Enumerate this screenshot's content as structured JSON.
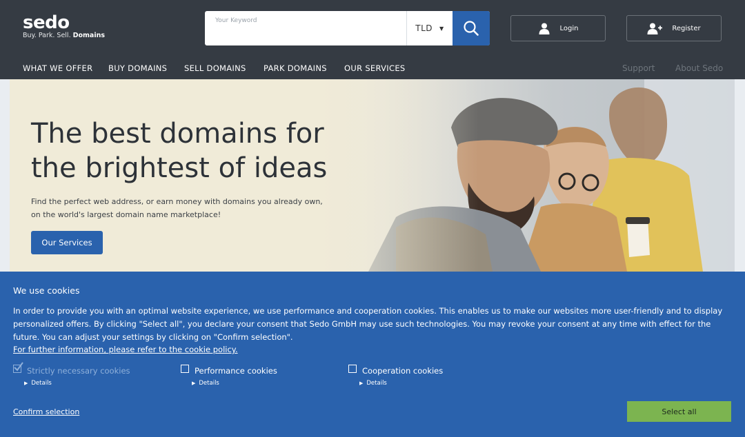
{
  "brand": {
    "name": "sedo",
    "tagline_prefix": "Buy. Park. Sell.",
    "tagline_bold": "Domains"
  },
  "search": {
    "placeholder": "Your Keyword",
    "value": "",
    "tld_label": "TLD",
    "icon": "search-icon"
  },
  "auth": {
    "login_label": "Login",
    "login_icon": "user-icon",
    "register_label": "Register",
    "register_icon": "user-plus-icon"
  },
  "nav": {
    "items": [
      {
        "label": "WHAT WE OFFER"
      },
      {
        "label": "BUY DOMAINS"
      },
      {
        "label": "SELL DOMAINS"
      },
      {
        "label": "PARK DOMAINS"
      },
      {
        "label": "OUR SERVICES"
      }
    ],
    "support_label": "Support",
    "about_label": "About Sedo"
  },
  "hero": {
    "title_line1": "The best domains for",
    "title_line2": "the brightest of ideas",
    "subtitle": "Find the perfect web address, or earn money with domains you already own, on the world's largest domain name marketplace!",
    "button_label": "Our Services"
  },
  "cookies": {
    "title": "We use cookies",
    "text": "In order to provide you with an optimal website experience, we use performance and cooperation cookies. This enables us to make our websites more user-friendly and to display personalized offers. By clicking \"Select all\", you declare your consent that Sedo GmbH may use such technologies. You may revoke your consent at any time with effect for the future. You can adjust your settings by clicking on \"Confirm selection\".",
    "policy_link": "For further information, please refer to the cookie policy.",
    "options": [
      {
        "label": "Strictly necessary cookies",
        "details": "Details",
        "checked": true,
        "disabled": true
      },
      {
        "label": "Performance cookies",
        "details": "Details",
        "checked": false,
        "disabled": false
      },
      {
        "label": "Cooperation cookies",
        "details": "Details",
        "checked": false,
        "disabled": false
      }
    ],
    "confirm_label": "Confirm selection",
    "select_all_label": "Select all"
  },
  "colors": {
    "header_bg": "#353b43",
    "accent_blue": "#2a62ad",
    "select_all_green": "#7cb450"
  }
}
